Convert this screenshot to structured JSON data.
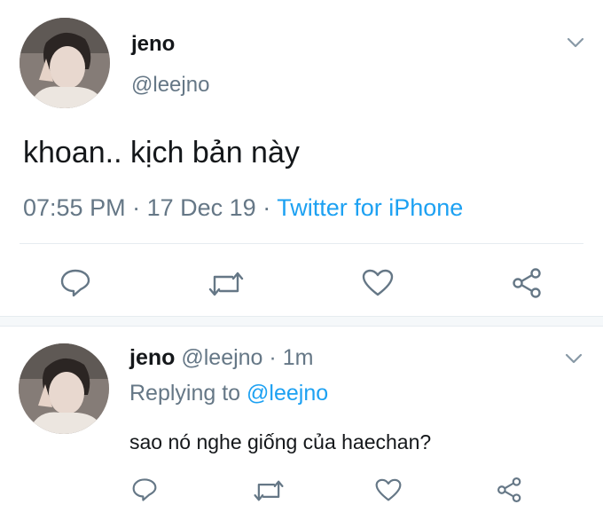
{
  "main_tweet": {
    "display_name": "jeno",
    "handle": "@leejno",
    "text": "khoan.. kịch bản này",
    "time": "07:55 PM",
    "date": "17 Dec 19",
    "dot": "·",
    "source": "Twitter for iPhone"
  },
  "reply_tweet": {
    "display_name": "jeno",
    "handle": "@leejno",
    "dot": "·",
    "age": "1m",
    "replying_prefix": "Replying to",
    "replying_handle": "@leejno",
    "text": "sao nó nghe giống của haechan?"
  },
  "icons": {
    "menu": "chevron-down-icon",
    "reply": "reply-icon",
    "retweet": "retweet-icon",
    "like": "heart-icon",
    "share": "share-icon"
  },
  "colors": {
    "text": "#14171a",
    "muted": "#657786",
    "link": "#1da1f2",
    "divider": "#e6ecf0"
  }
}
